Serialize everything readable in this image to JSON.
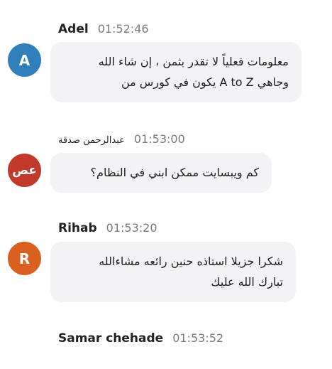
{
  "messages": [
    {
      "author": "Adel",
      "time": "01:52:46",
      "avatar_text": "A",
      "avatar_color": "#2f7fbd",
      "lines": [
        "معلومات فعلياً لا تقدر بثمن ، إن شاء الله",
        "وجاهي A to Z يكون في كورس من"
      ]
    },
    {
      "author": "عبدالرحمن صدقة",
      "time": "01:53:00",
      "avatar_text": "عص",
      "avatar_color": "#c0392b",
      "lines": [
        "كم ويبسايت ممكن ابني في النظام؟"
      ]
    },
    {
      "author": "Rihab",
      "time": "01:53:20",
      "avatar_text": "R",
      "avatar_color": "#d9601f",
      "lines": [
        "شكرا جزيلا استاذه حنين رائعه مشاءالله",
        "تبارك الله عليك"
      ]
    },
    {
      "author": "Samar chehade",
      "time": "01:53:52"
    }
  ]
}
